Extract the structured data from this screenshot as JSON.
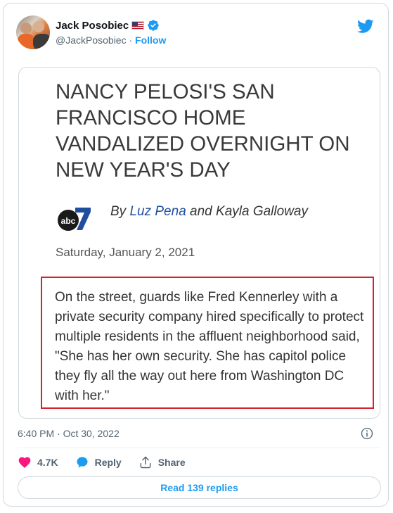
{
  "author": {
    "name": "Jack Posobiec",
    "handle": "@JackPosobiec",
    "separator": "·",
    "follow_label": "Follow"
  },
  "article": {
    "headline": "NANCY PELOSI'S SAN FRANCISCO HOME VANDALIZED OVERNIGHT ON NEW YEAR'S DAY",
    "byline_prefix": "By",
    "author1": "Luz Pena",
    "byline_and": "and Kayla Galloway",
    "date": "Saturday, January 2, 2021",
    "quote": "On the street, guards like Fred Kennerley with a private security company hired specifically to protect multiple residents in the affluent neighborhood said, \"She has her own security. She has capitol police they fly all the way out here from Washington DC with her.\""
  },
  "tweet": {
    "timestamp": "6:40 PM · Oct 30, 2022",
    "likes": "4.7K",
    "reply_label": "Reply",
    "share_label": "Share",
    "read_replies_label": "Read 139 replies"
  },
  "colors": {
    "brand_blue": "#1d9bf0",
    "like_pink": "#f91880",
    "highlight_red": "#d4232b",
    "byline_blue": "#1f4e9e"
  },
  "icons": [
    "twitter-logo-icon",
    "verified-badge-icon",
    "us-flag-icon",
    "abc7-logo-icon",
    "info-icon",
    "heart-icon",
    "reply-bubble-icon",
    "share-icon"
  ]
}
